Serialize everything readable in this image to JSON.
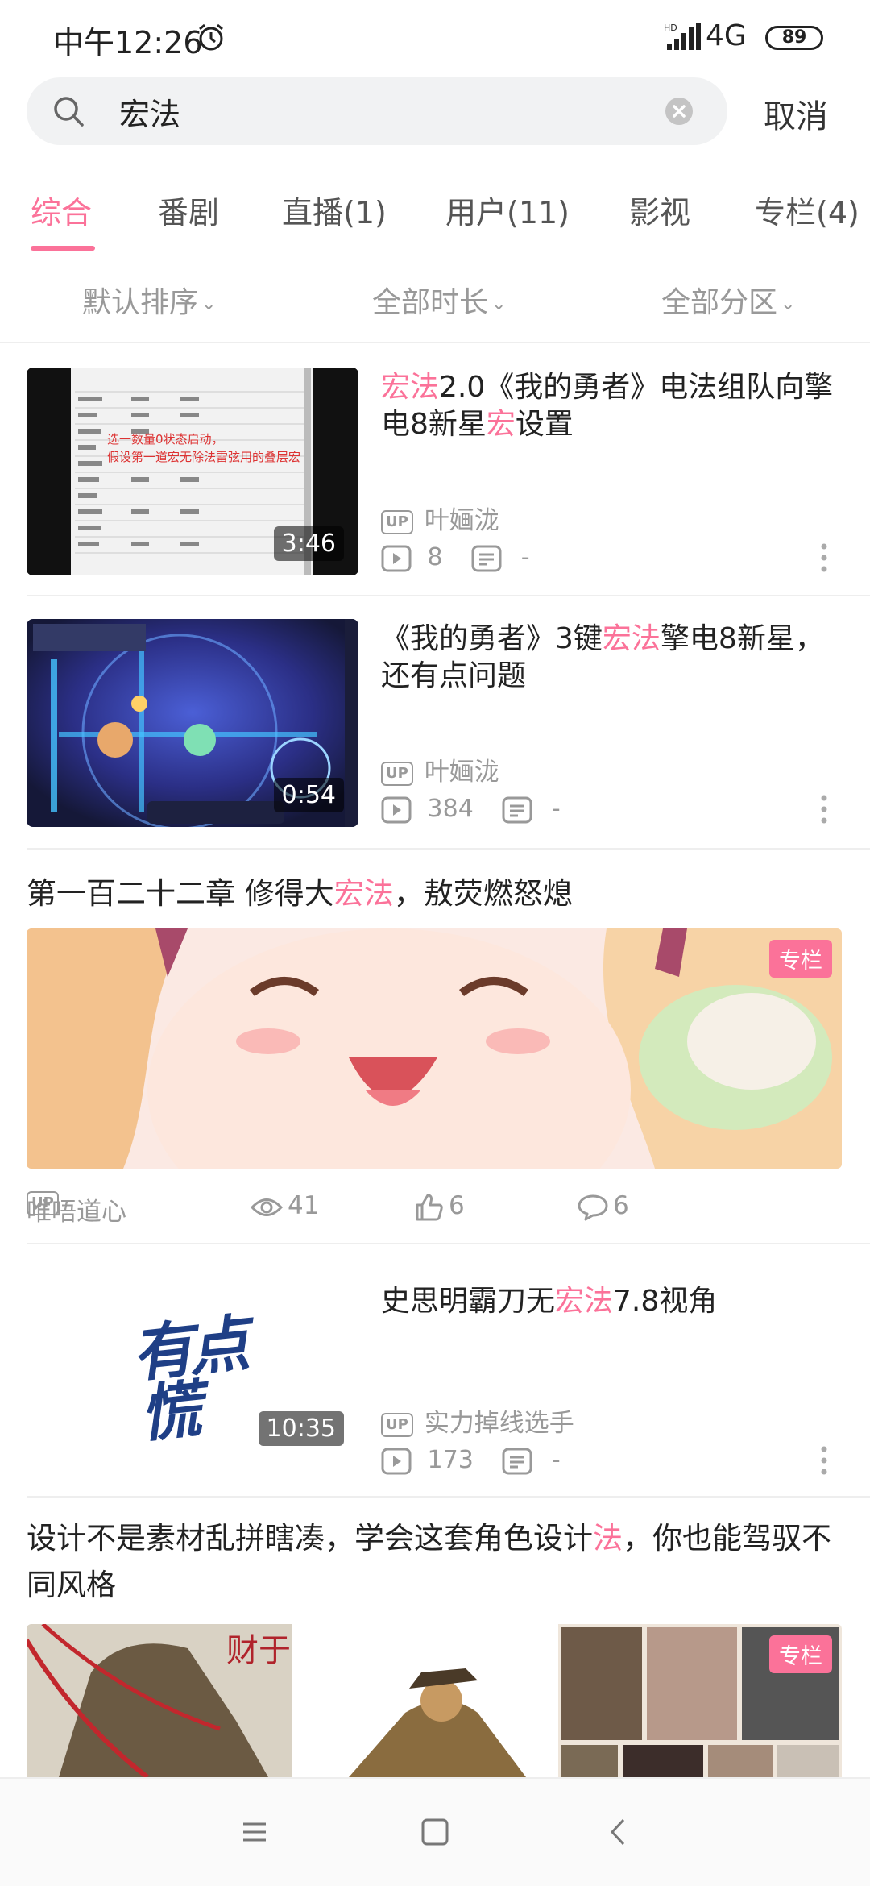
{
  "status_bar": {
    "time": "中午12:26",
    "network": "4G",
    "battery": "89"
  },
  "search": {
    "query": "宏法",
    "cancel_label": "取消"
  },
  "tabs": [
    {
      "label": "综合"
    },
    {
      "label": "番剧"
    },
    {
      "label": "直播(1)"
    },
    {
      "label": "用户(11)"
    },
    {
      "label": "影视"
    },
    {
      "label": "专栏(4)"
    }
  ],
  "filters": {
    "sort": "默认排序",
    "duration": "全部时长",
    "zone": "全部分区"
  },
  "results": {
    "video1": {
      "title_parts": [
        "宏法",
        "2.0《我的勇者》电法组队向擎电8新星",
        "宏",
        "设置"
      ],
      "duration": "3:46",
      "up_badge": "UP",
      "author": "叶婳泷",
      "plays": "8",
      "danmaku": "-",
      "thumb_text": "选一数量0状态启动，\n假设第一道宏无除法雷弦用的叠层宏"
    },
    "video2": {
      "title_parts": [
        "《我的勇者》3键",
        "宏法",
        "擎电8新星，还有点问题"
      ],
      "duration": "0:54",
      "up_badge": "UP",
      "author": "叶婳泷",
      "plays": "384",
      "danmaku": "-"
    },
    "article1": {
      "title_parts": [
        "第一百二十二章 修得大",
        "宏法",
        "，敖荧燃怒熄"
      ],
      "tag": "专栏",
      "up_badge": "UP",
      "author": "唯唔道心",
      "views": "41",
      "likes": "6",
      "comments": "6"
    },
    "video3": {
      "title_parts": [
        "史思明霸刀无",
        "宏法",
        "7.8视角"
      ],
      "duration": "10:35",
      "up_badge": "UP",
      "author": "实力掉线选手",
      "plays": "173",
      "danmaku": "-",
      "thumb_calligraphy_1": "有点",
      "thumb_calligraphy_2": "慌"
    },
    "article2": {
      "title_parts": [
        "设计不是素材乱拼瞎凑，学会这套角色设计",
        "法",
        "，你也能驾驭不同风格"
      ],
      "tag": "专栏",
      "image_text": "财于"
    }
  },
  "colors": {
    "accent": "#fb7299",
    "muted": "#999999",
    "text": "#222222"
  }
}
